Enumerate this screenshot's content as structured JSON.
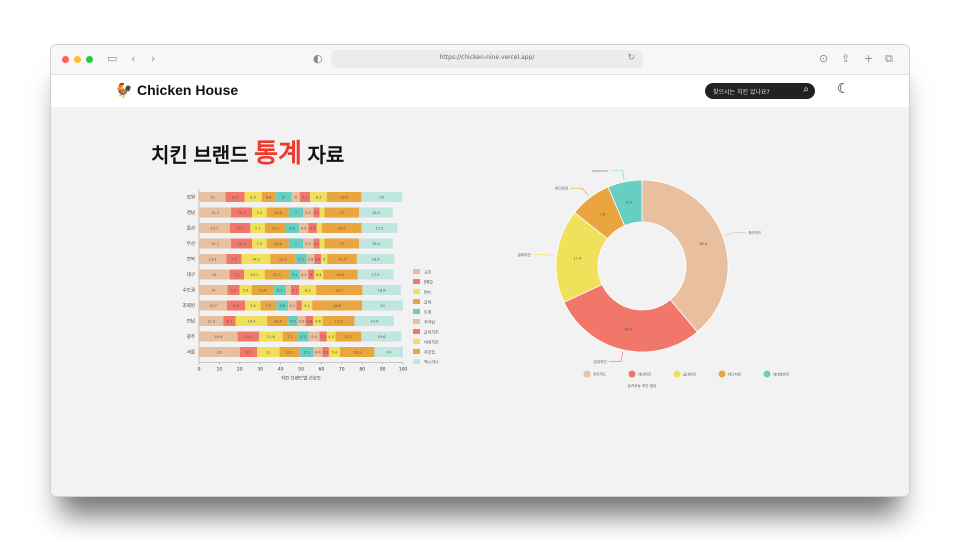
{
  "browser": {
    "url": "https://chicken-nine.vercel.app/"
  },
  "nav": {
    "brand": "Chicken House",
    "search_placeholder": "찾으시는 치킨 있나요?"
  },
  "headline": {
    "before": "치킨 브랜드",
    "accent": "통계",
    "after": "자료"
  },
  "colors": {
    "accent": "#f0392f",
    "palette": [
      "#e8c0a0",
      "#f0776a",
      "#f1e05a",
      "#e9a53e",
      "#67cfc1",
      "#e8c0a0",
      "#f0776a",
      "#f1e05a",
      "#e9a53e"
    ]
  },
  "bar_chart": {
    "type": "bar",
    "orientation": "horizontal-stacked",
    "xlabel": "치킨 브랜드별 선호도",
    "xlim": [
      0,
      100
    ],
    "xticks": [
      "0",
      "10",
      "20",
      "30",
      "40",
      "50",
      "60",
      "70",
      "80",
      "90",
      "100"
    ],
    "categories": [
      "강원",
      "경남",
      "울산",
      "부산",
      "전북",
      "대구",
      "수도권",
      "조회된",
      "전남",
      "광주",
      "서울"
    ],
    "series": [
      {
        "name": "교촌",
        "values": [
          13.0,
          15.7,
          15.1,
          15.7,
          13.4,
          15.0,
          14.0,
          13.7,
          11.9,
          18.9,
          20.0
        ]
      },
      {
        "name": "BBQ",
        "values": [
          9.3,
          10.3,
          10.1,
          10.3,
          7.4,
          7.1,
          5.9,
          8.9,
          6.1,
          10.5,
          8.5
        ]
      },
      {
        "name": "bhc",
        "values": [
          8.5,
          7.2,
          7.1,
          7.2,
          14.2,
          10.1,
          5.9,
          7.6,
          15.4,
          11.6,
          11.0
        ]
      },
      {
        "name": "굽네",
        "values": [
          6.6,
          10.8,
          10.1,
          10.8,
          12.2,
          12.1,
          10.6,
          7.7,
          10.4,
          7.2,
          10.1
        ]
      },
      {
        "name": "또래",
        "values": [
          8.0,
          7.0,
          6.6,
          7.0,
          5.5,
          5.1,
          6.3,
          5.8,
          4.5,
          5.5,
          6.5
        ]
      },
      {
        "name": "푸라닭",
        "values": [
          4.0,
          5.1,
          4.5,
          5.1,
          3.8,
          4.1,
          2.3,
          4.1,
          3.9,
          5.4,
          4.4
        ]
      },
      {
        "name": "굽네치킨",
        "values": [
          5.1,
          3.1,
          4.3,
          3.1,
          3.4,
          3.0,
          4.1,
          2.6,
          3.8,
          3.5,
          3.2
        ]
      },
      {
        "name": "네네치킨",
        "values": [
          8.2,
          2.3,
          2.4,
          2.3,
          3.0,
          4.4,
          8.3,
          5.1,
          4.6,
          4.3,
          5.4
        ]
      },
      {
        "name": "처갓집",
        "values": [
          16.9,
          17.0,
          19.5,
          17.0,
          14.5,
          16.9,
          22.7,
          24.5,
          15.6,
          12.7,
          16.9
        ]
      },
      {
        "name": "멕시카나",
        "values": [
          20.0,
          16.5,
          17.5,
          16.5,
          18.4,
          17.5,
          18.8,
          20.0,
          19.4,
          19.6,
          14.0
        ]
      }
    ]
  },
  "donut_chart": {
    "type": "pie",
    "caption": "돈카우농 치킨 점유",
    "slices": [
      {
        "label": "푸라닥드",
        "value": 38.5
      },
      {
        "label": "강강치킨",
        "value": 28.9
      },
      {
        "label": "굽네치킨",
        "value": 17.4
      },
      {
        "label": "바다치킨",
        "value": 7.8
      },
      {
        "label": "네네호치킨",
        "value": 6.4
      }
    ],
    "legend": [
      "푸라닥드",
      "네네치킨",
      "굽네치킨",
      "바다치킨",
      "네네호치킨"
    ]
  }
}
